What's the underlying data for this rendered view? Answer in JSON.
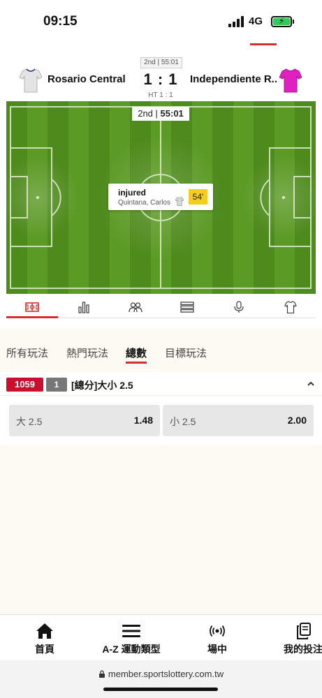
{
  "status_bar": {
    "time": "09:15",
    "network": "4G"
  },
  "match": {
    "period_time": "2nd | 55:01",
    "home_team": "Rosario Central",
    "away_team": "Independiente R...",
    "score": "1 : 1",
    "ht_score": "HT 1 : 1",
    "home_color": "#e4e4e4",
    "away_color": "#e020c0"
  },
  "pitch": {
    "period": "2nd",
    "clock": "55:01",
    "grass_light": "#5c9a26",
    "grass_dark": "#4e8a1c",
    "event": {
      "type": "injured",
      "player": "Quintana, Carlos",
      "minute": "54'"
    }
  },
  "icon_tabs": [
    {
      "icon": "pitch-icon",
      "active": true
    },
    {
      "icon": "bar-chart-icon",
      "active": false
    },
    {
      "icon": "players-icon",
      "active": false
    },
    {
      "icon": "list-icon",
      "active": false
    },
    {
      "icon": "microphone-icon",
      "active": false
    },
    {
      "icon": "jersey-icon",
      "active": false
    }
  ],
  "market_tabs": [
    {
      "label": "所有玩法",
      "active": false
    },
    {
      "label": "熱門玩法",
      "active": false
    },
    {
      "label": "總數",
      "active": true
    },
    {
      "label": "目標玩法",
      "active": false
    }
  ],
  "market": {
    "id": "1059",
    "count": "1",
    "title": "[總分]大小 2.5",
    "selections": [
      {
        "label": "大 2.5",
        "odds": "1.48"
      },
      {
        "label": "小 2.5",
        "odds": "2.00"
      }
    ]
  },
  "bottom_nav": [
    {
      "label": "首頁",
      "icon": "home-icon"
    },
    {
      "label": "A-Z 運動類型",
      "icon": "menu-icon"
    },
    {
      "label": "場中",
      "icon": "live-broadcast-icon"
    },
    {
      "label": "我的投注",
      "icon": "bet-slip-icon"
    }
  ],
  "url": "member.sportslottery.com.tw",
  "accent_color": "#d32f2f"
}
